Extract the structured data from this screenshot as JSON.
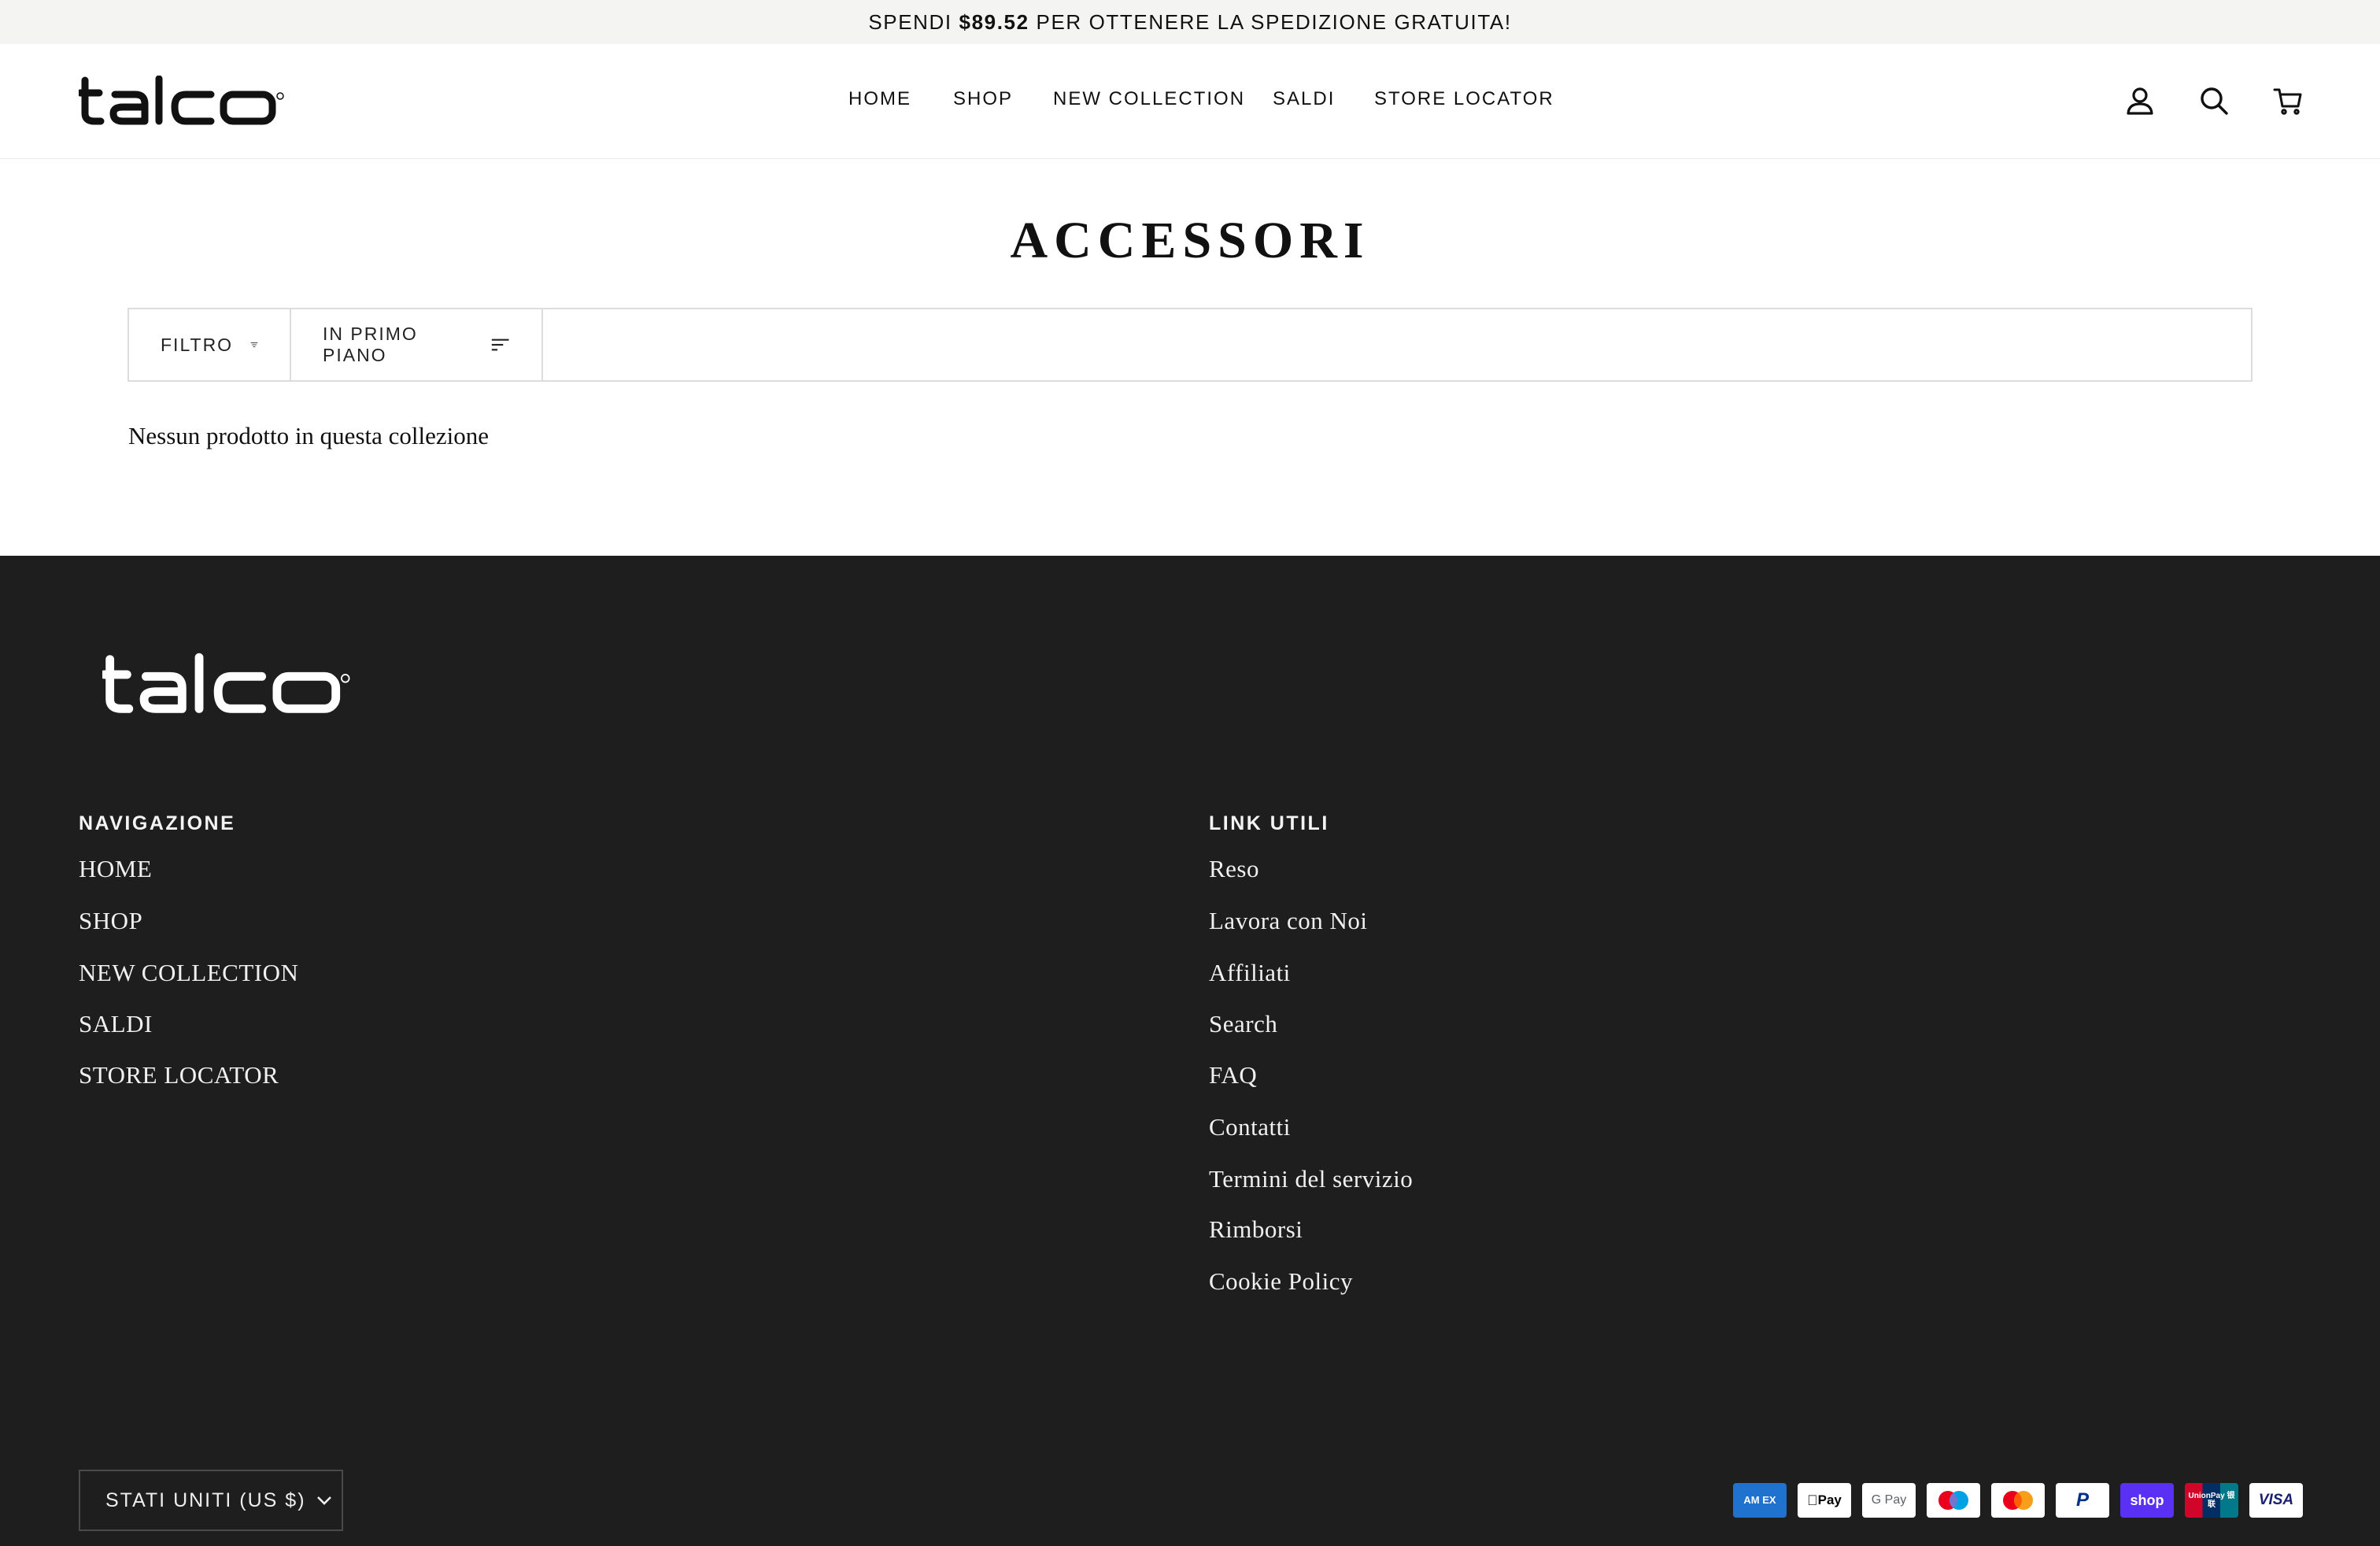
{
  "announcement": {
    "prefix": "SPENDI",
    "amount": "$89.52",
    "suffix": "PER OTTENERE LA SPEDIZIONE GRATUITA!"
  },
  "header": {
    "logo_text": "talco",
    "nav": [
      "HOME",
      "SHOP",
      "NEW COLLECTION",
      "SALDI",
      "STORE LOCATOR"
    ],
    "icons": [
      "account-icon",
      "search-icon",
      "cart-icon"
    ]
  },
  "collection": {
    "title": "ACCESSORI",
    "filter_label": "FILTRO",
    "sort_label": "IN PRIMO PIANO",
    "empty_message": "Nessun prodotto in questa collezione"
  },
  "footer": {
    "logo_text": "talco",
    "nav_heading": "NAVIGAZIONE",
    "nav_links": [
      "HOME",
      "SHOP",
      "NEW COLLECTION",
      "SALDI",
      "STORE LOCATOR"
    ],
    "links_heading": "LINK UTILI",
    "useful_links": [
      "Reso",
      "Lavora con Noi",
      "Affiliati",
      "Search",
      "FAQ",
      "Contatti",
      "Termini del servizio",
      "Rimborsi",
      "Cookie Policy"
    ],
    "currency_selector": "STATI UNITI (US $)",
    "payment_methods": [
      {
        "name": "amex-icon",
        "label": "AM EX",
        "bg": "#1f72cd",
        "fg": "#ffffff"
      },
      {
        "name": "apple-pay-icon",
        "label": "Pay",
        "bg": "#ffffff",
        "fg": "#000000"
      },
      {
        "name": "google-pay-icon",
        "label": "G Pay",
        "bg": "#ffffff",
        "fg": "#5f6368"
      },
      {
        "name": "maestro-icon",
        "label": "",
        "bg": "#ffffff",
        "fg": "#000000"
      },
      {
        "name": "mastercard-icon",
        "label": "",
        "bg": "#ffffff",
        "fg": "#000000"
      },
      {
        "name": "paypal-icon",
        "label": "P",
        "bg": "#ffffff",
        "fg": "#003087"
      },
      {
        "name": "shop-pay-icon",
        "label": "shop",
        "bg": "#5a31f4",
        "fg": "#ffffff"
      },
      {
        "name": "unionpay-icon",
        "label": "UnionPay 银联",
        "bg": "#01798a",
        "fg": "#ffffff"
      },
      {
        "name": "visa-icon",
        "label": "VISA",
        "bg": "#ffffff",
        "fg": "#1a1f71"
      }
    ]
  }
}
